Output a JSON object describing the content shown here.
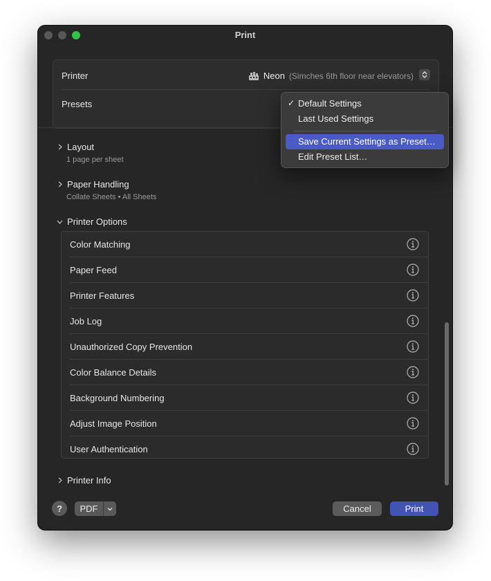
{
  "window": {
    "title": "Print"
  },
  "printer": {
    "label": "Printer",
    "name": "Neon",
    "location": "(Simches 6th floor near elevators)",
    "icon": "printer-icon"
  },
  "presets": {
    "label": "Presets",
    "menu": [
      {
        "label": "Default Settings",
        "checked": true
      },
      {
        "label": "Last Used Settings"
      },
      {
        "label": "Save Current Settings as Preset…",
        "highlighted": true
      },
      {
        "label": "Edit Preset List…"
      }
    ]
  },
  "sections": {
    "layout": {
      "title": "Layout",
      "subtitle": "1 page per sheet"
    },
    "paper_handling": {
      "title": "Paper Handling",
      "subtitle": "Collate Sheets • All Sheets"
    },
    "printer_options": {
      "title": "Printer Options",
      "items": [
        "Color Matching",
        "Paper Feed",
        "Printer Features",
        "Job Log",
        "Unauthorized Copy Prevention",
        "Color Balance Details",
        "Background Numbering",
        "Adjust Image Position",
        "User Authentication"
      ]
    },
    "printer_info": {
      "title": "Printer Info"
    }
  },
  "footer": {
    "help": "?",
    "pdf": "PDF",
    "cancel": "Cancel",
    "print": "Print"
  },
  "colors": {
    "accent": "#4353b5",
    "menu_highlight": "#4b5bc6",
    "window_bg": "#262626",
    "zoom_button": "#2fc545"
  }
}
